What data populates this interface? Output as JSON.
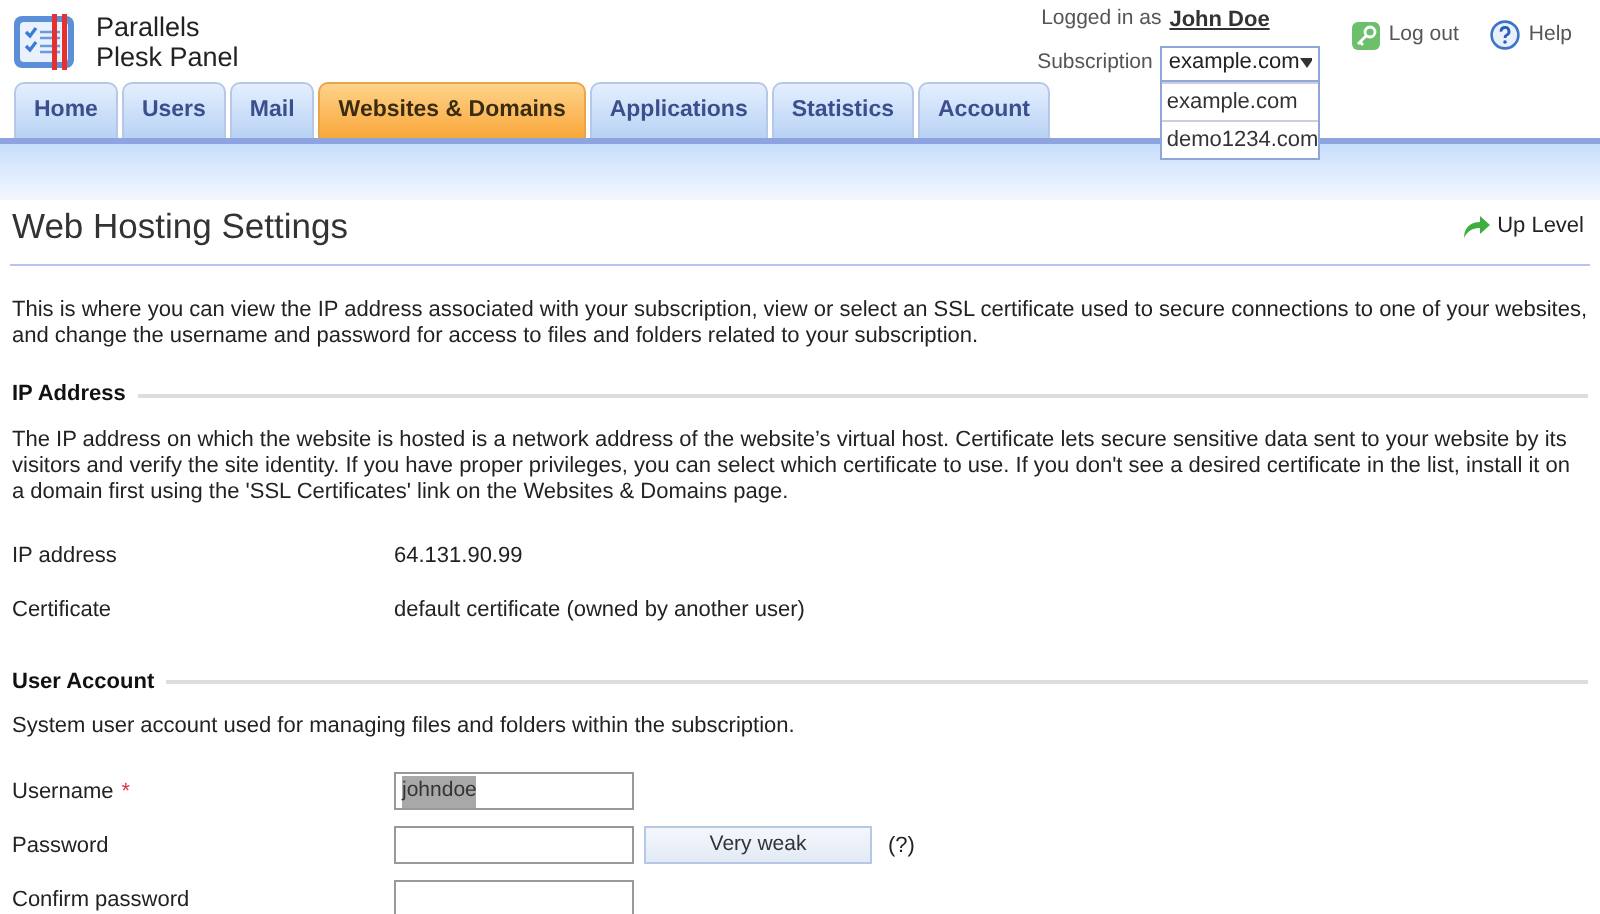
{
  "logo": {
    "line1": "Parallels",
    "line2": "Plesk Panel"
  },
  "header": {
    "logged_in_label": "Logged in as",
    "user": "John Doe",
    "subscription_label": "Subscription",
    "subscription": {
      "value": "example.com",
      "expanded": true,
      "options": [
        "example.com",
        "demo1234.com"
      ]
    },
    "logout": "Log out",
    "help": "Help"
  },
  "tabs": [
    {
      "label": "Home",
      "selected": false
    },
    {
      "label": "Users",
      "selected": false
    },
    {
      "label": "Mail",
      "selected": false
    },
    {
      "label": "Websites & Domains",
      "selected": true
    },
    {
      "label": "Applications",
      "selected": false
    },
    {
      "label": "Statistics",
      "selected": false
    },
    {
      "label": "Account",
      "selected": false
    }
  ],
  "page": {
    "title": "Web Hosting Settings",
    "up_level": "Up Level",
    "intro": "This is where you can view the IP address associated with your subscription, view or select an SSL certificate used to secure connections to one of your websites, and change the username and password for access to files and folders related to your subscription."
  },
  "sections": [
    {
      "title": "IP Address",
      "description": "The IP address on which the website is hosted is a network address of the website’s virtual host. Certificate lets secure sensitive data sent to your website by its visitors and verify the site identity. If you have proper privileges, you can select which certificate to use. If you don't see a desired certificate in the list, install it on a domain first using the 'SSL Certificates' link on the Websites & Domains page.",
      "fields": [
        {
          "kind": "static",
          "label": "IP address",
          "value": "64.131.90.99"
        },
        {
          "kind": "static",
          "label": "Certificate",
          "value": "default certificate (owned by another user)"
        }
      ]
    },
    {
      "title": "User Account",
      "description": "System user account used for managing files and folders within the subscription.",
      "fields": [
        {
          "kind": "input",
          "label": "Username",
          "required_mark": "*",
          "value": "johndoe",
          "text_selected": true
        },
        {
          "kind": "password",
          "label": "Password",
          "strength": "Very weak",
          "hint": "(?)"
        },
        {
          "kind": "input",
          "label": "Confirm password"
        }
      ]
    }
  ]
}
